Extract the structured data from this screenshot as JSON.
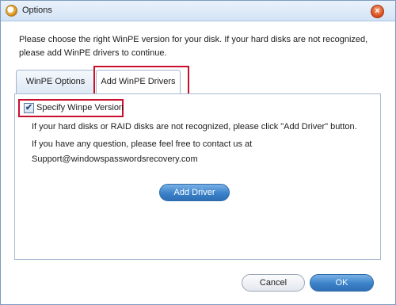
{
  "window": {
    "title": "Options",
    "close_glyph": "×"
  },
  "instruction": "Please choose the right WinPE version for your disk. If your hard disks are not recognized, please add WinPE drivers to continue.",
  "tabs": [
    {
      "label": "WinPE Options",
      "selected": false
    },
    {
      "label": "Add WinPE Drivers",
      "selected": true
    }
  ],
  "checkbox": {
    "label": "Specify Winpe Version",
    "checked": true,
    "glyph": "✔"
  },
  "body_text": {
    "line1": "If your hard disks or RAID disks are not recognized, please click \"Add Driver\" button.",
    "line2": "If you have any question, please feel free to contact us at",
    "line3": "Support@windowspasswordsrecovery.com"
  },
  "buttons": {
    "add_driver": "Add Driver",
    "cancel": "Cancel",
    "ok": "OK"
  },
  "colors": {
    "accent_blue": "#3b82c9",
    "highlight_red": "#c8102e"
  }
}
